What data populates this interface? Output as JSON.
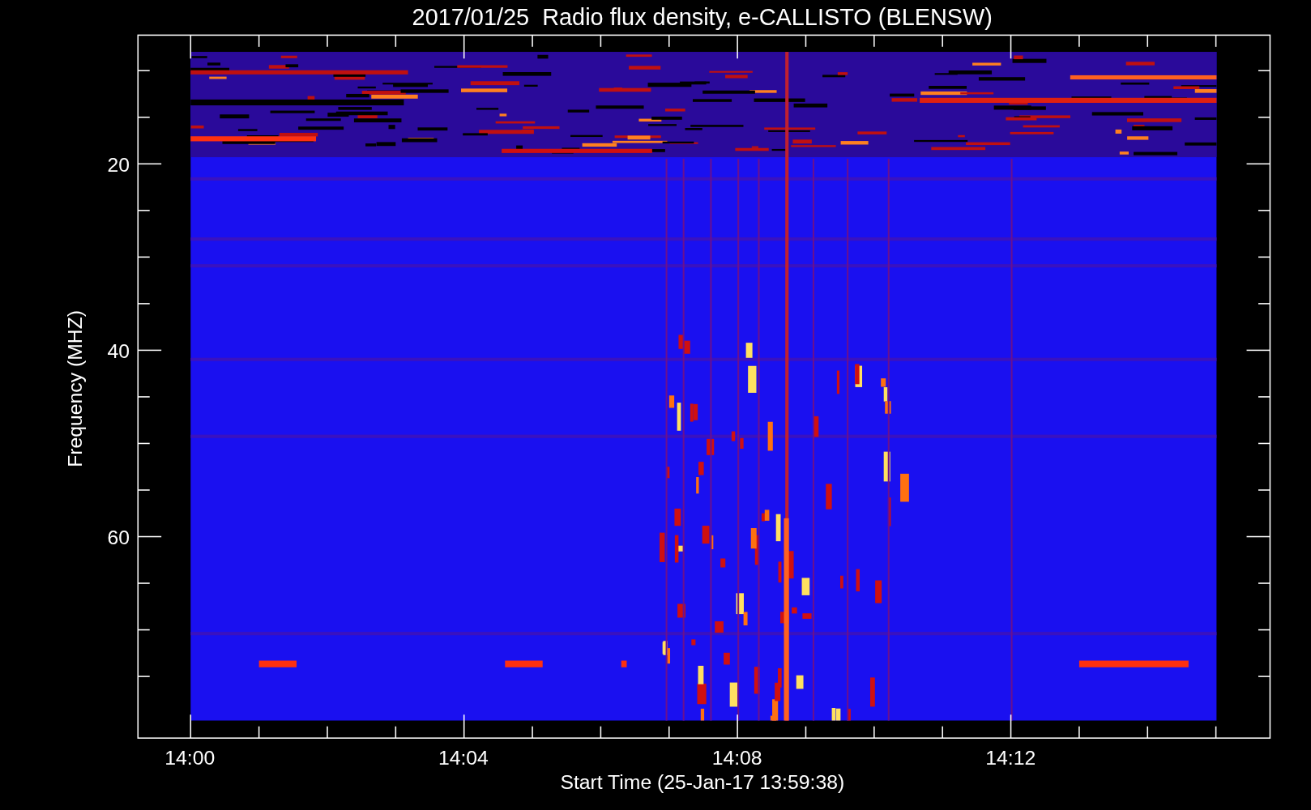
{
  "title": "2017/01/25  Radio flux density, e-CALLISTO (BLENSW)",
  "y_axis": {
    "label": "Frequency (MHZ)",
    "ticks": [
      "20",
      "40",
      "60"
    ]
  },
  "x_axis": {
    "label": "Start Time (25-Jan-17 13:59:38)",
    "ticks": [
      "14:00",
      "14:04",
      "14:08",
      "14:12"
    ]
  }
}
